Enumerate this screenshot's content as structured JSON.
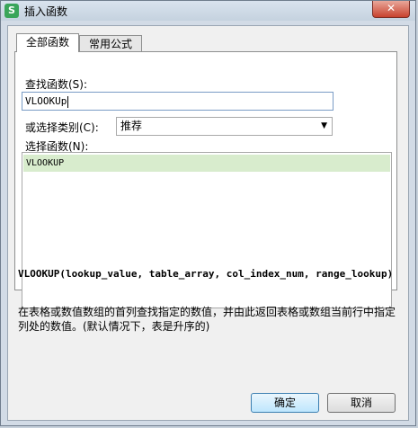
{
  "window": {
    "title": "插入函数",
    "app_icon_text": "S",
    "close_symbol": "✕"
  },
  "tabs": [
    {
      "label": "全部函数",
      "active": true
    },
    {
      "label": "常用公式",
      "active": false
    }
  ],
  "search": {
    "label": "查找函数(S):",
    "value": "VLOOKUp"
  },
  "category": {
    "label": "或选择类别(C):",
    "selected": "推荐"
  },
  "functions": {
    "label": "选择函数(N):",
    "items": [
      "VLOOKUP"
    ]
  },
  "signature": "VLOOKUP(lookup_value, table_array, col_index_num, range_lookup)",
  "description": "在表格或数值数组的首列查找指定的数值，并由此返回表格或数组当前行中指定列处的数值。(默认情况下，表是升序的)",
  "buttons": {
    "ok": "确定",
    "cancel": "取消"
  },
  "colors": {
    "selection": "#d8eccd",
    "close": "#c8422e",
    "app_icon": "#3aa55a"
  }
}
